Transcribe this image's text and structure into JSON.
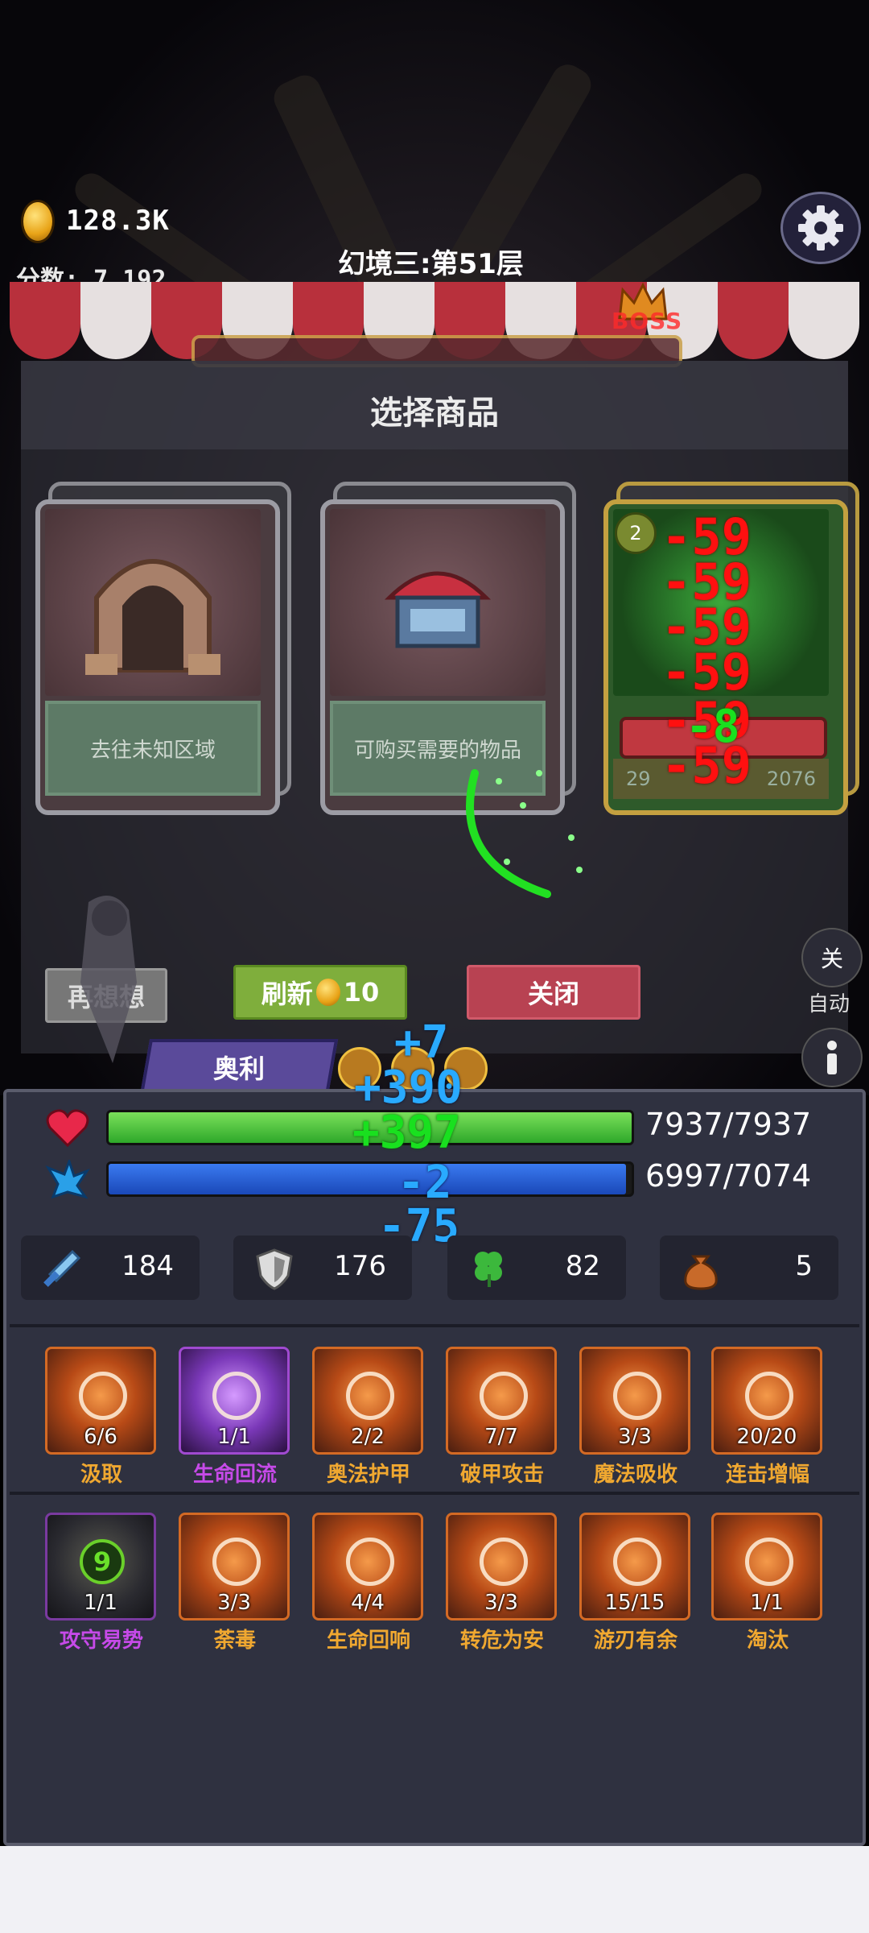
{
  "hud": {
    "gold": "128.3K",
    "score": "分数: 7,192",
    "level": "幻境三:第51层",
    "boss_label": "BOSS"
  },
  "shop": {
    "title": "选择商品",
    "cards": [
      {
        "caption": "去往未知区域"
      },
      {
        "caption": "可购买需要的物品"
      },
      {
        "badge": "2",
        "stats": [
          "29",
          "2076"
        ]
      }
    ]
  },
  "combat_text": {
    "red": [
      "-59",
      "-59",
      "-59",
      "-59",
      "-59",
      "-59"
    ],
    "green_small": "-8",
    "plus1": "+7",
    "plus2": "+390",
    "plus3": "+397",
    "minus1": "-2",
    "minus2": "-75"
  },
  "buttons": {
    "rethink": "再想想",
    "refresh": "刷新",
    "refresh_cost": "10",
    "close": "关闭",
    "toggle": "关",
    "auto": "自动"
  },
  "player": {
    "name": "奥利",
    "hp": "7937/7937",
    "hp_fraction": 1.0,
    "mp": "6997/7074",
    "mp_fraction": 0.989
  },
  "stats": [
    {
      "icon": "sword-icon",
      "value": "184"
    },
    {
      "icon": "shield-icon",
      "value": "176"
    },
    {
      "icon": "clover-icon",
      "value": "82"
    },
    {
      "icon": "money-bag-icon",
      "value": "5"
    }
  ],
  "skills_row1": [
    {
      "name": "汲取",
      "count": "6/6",
      "style": "orange"
    },
    {
      "name": "生命回流",
      "count": "1/1",
      "style": "purple"
    },
    {
      "name": "奥法护甲",
      "count": "2/2",
      "style": "orange"
    },
    {
      "name": "破甲攻击",
      "count": "7/7",
      "style": "orange"
    },
    {
      "name": "魔法吸收",
      "count": "3/3",
      "style": "orange"
    },
    {
      "name": "连击增幅",
      "count": "20/20",
      "style": "orange"
    }
  ],
  "skills_row2": [
    {
      "name": "攻守易势",
      "count": "1/1",
      "style": "dark",
      "badge": "9"
    },
    {
      "name": "荼毒",
      "count": "3/3",
      "style": "orange"
    },
    {
      "name": "生命回响",
      "count": "4/4",
      "style": "orange"
    },
    {
      "name": "转危为安",
      "count": "3/3",
      "style": "orange"
    },
    {
      "name": "游刃有余",
      "count": "15/15",
      "style": "orange"
    },
    {
      "name": "淘汰",
      "count": "1/1",
      "style": "orange"
    }
  ],
  "colors": {
    "hp": "#3cc43a",
    "mp": "#1f5cd6",
    "skill_name": "#f0a830",
    "skill_name_purple": "#c64ae8"
  }
}
